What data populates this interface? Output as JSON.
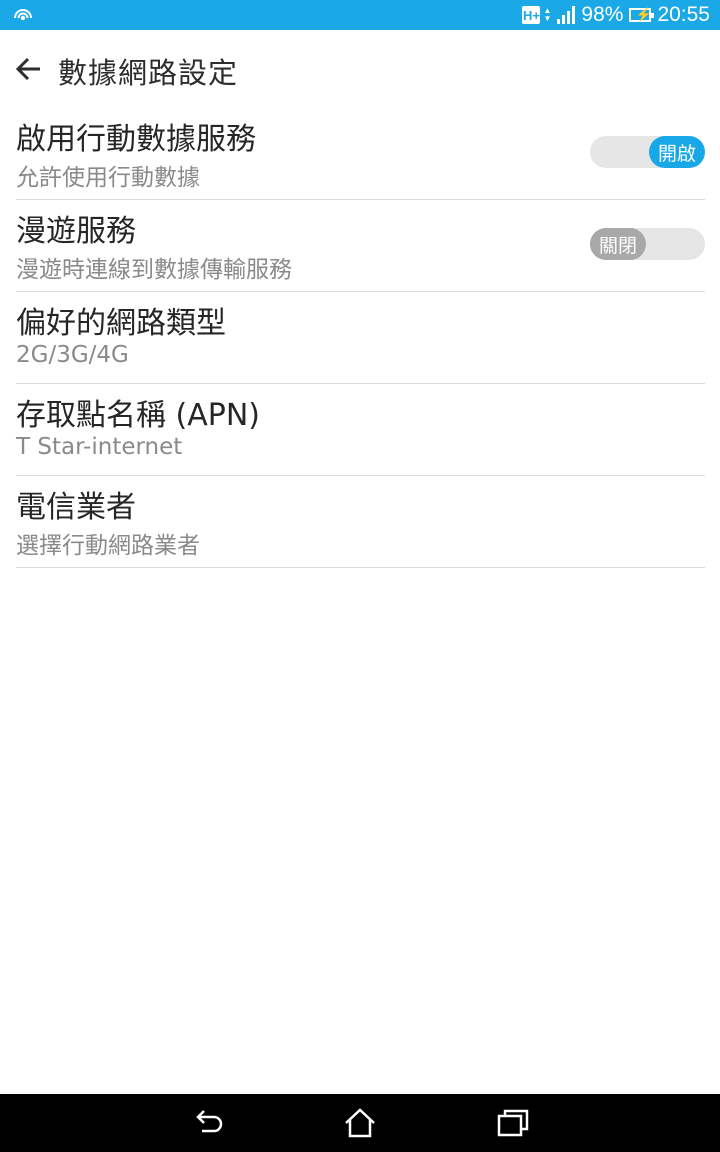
{
  "status_bar": {
    "network_type": "H+",
    "battery_percent": "98%",
    "time": "20:55",
    "icons": [
      "wifi-hotspot-icon",
      "hplus-network-icon",
      "signal-strength-icon",
      "battery-charging-icon"
    ]
  },
  "app_bar": {
    "title": "數據網路設定",
    "back_icon": "arrow-left-icon"
  },
  "settings": [
    {
      "title": "啟用行動數據服務",
      "summary": "允許使用行動數據",
      "toggle": {
        "state": "on",
        "label": "開啟"
      }
    },
    {
      "title": "漫遊服務",
      "summary": "漫遊時連線到數據傳輸服務",
      "toggle": {
        "state": "off",
        "label": "關閉"
      }
    },
    {
      "title": "偏好的網路類型",
      "summary": "2G/3G/4G"
    },
    {
      "title": "存取點名稱 (APN)",
      "summary": "T Star-internet"
    },
    {
      "title": "電信業者",
      "summary": "選擇行動網路業者"
    }
  ],
  "colors": {
    "status_bar": "#1aa9e6",
    "toggle_on": "#18a8e8",
    "toggle_off": "#a8a8a8",
    "nav_bar": "#000000"
  },
  "nav_bar": {
    "icons": [
      "back-nav-icon",
      "home-nav-icon",
      "recents-nav-icon"
    ]
  }
}
